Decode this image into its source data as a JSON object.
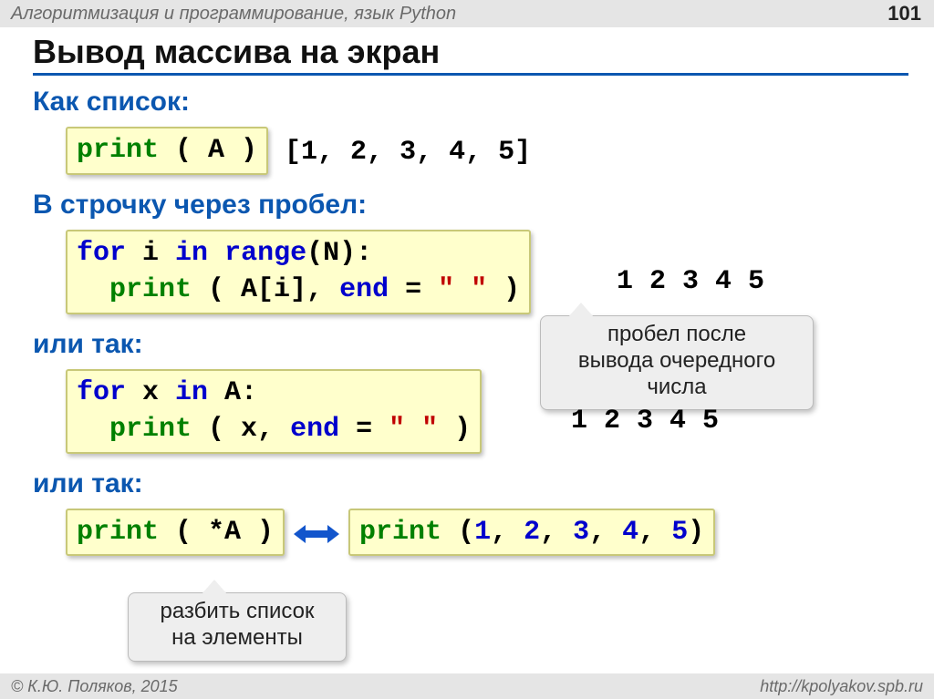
{
  "header": {
    "course": "Алгоритмизация и программирование, язык Python",
    "page": "101"
  },
  "title": "Вывод массива на экран",
  "section1": {
    "heading": "Как список:",
    "code_print": "print",
    "code_rest": " ( A )",
    "output": "[1, 2, 3, 4, 5]"
  },
  "section2": {
    "heading": "В строчку через пробел:",
    "line1": {
      "for": "for",
      "mid": " i ",
      "in": "in",
      "sp": " ",
      "range": "range",
      "rest": "(N):"
    },
    "line2": {
      "indent": "  ",
      "print": "print",
      "mid": " ( A[i], ",
      "end": "end",
      "eq": " = ",
      "str": "\" \"",
      "close": " )"
    },
    "output": "1 2 3 4 5"
  },
  "note1": {
    "l1": "пробел после",
    "l2": "вывода очередного",
    "l3": "числа"
  },
  "or1": "или так:",
  "section3": {
    "line1": {
      "for": "for",
      "mid": " x ",
      "in": "in",
      "rest": " A:"
    },
    "line2": {
      "indent": "  ",
      "print": "print",
      "mid": " ( x, ",
      "end": "end",
      "eq": " = ",
      "str": "\" \"",
      "close": " )"
    },
    "output": "1 2 3 4 5"
  },
  "or2": "или так:",
  "section4": {
    "left": {
      "print": "print",
      "rest": " ( *A )"
    },
    "right": {
      "print": "print",
      "open": " (",
      "n1": "1",
      "c": ", ",
      "n2": "2",
      "n3": "3",
      "n4": "4",
      "n5": "5",
      "close": ")"
    }
  },
  "note2": {
    "l1": "разбить список",
    "l2": "на элементы"
  },
  "footer": {
    "left": "© К.Ю. Поляков, 2015",
    "right": "http://kpolyakov.spb.ru"
  }
}
